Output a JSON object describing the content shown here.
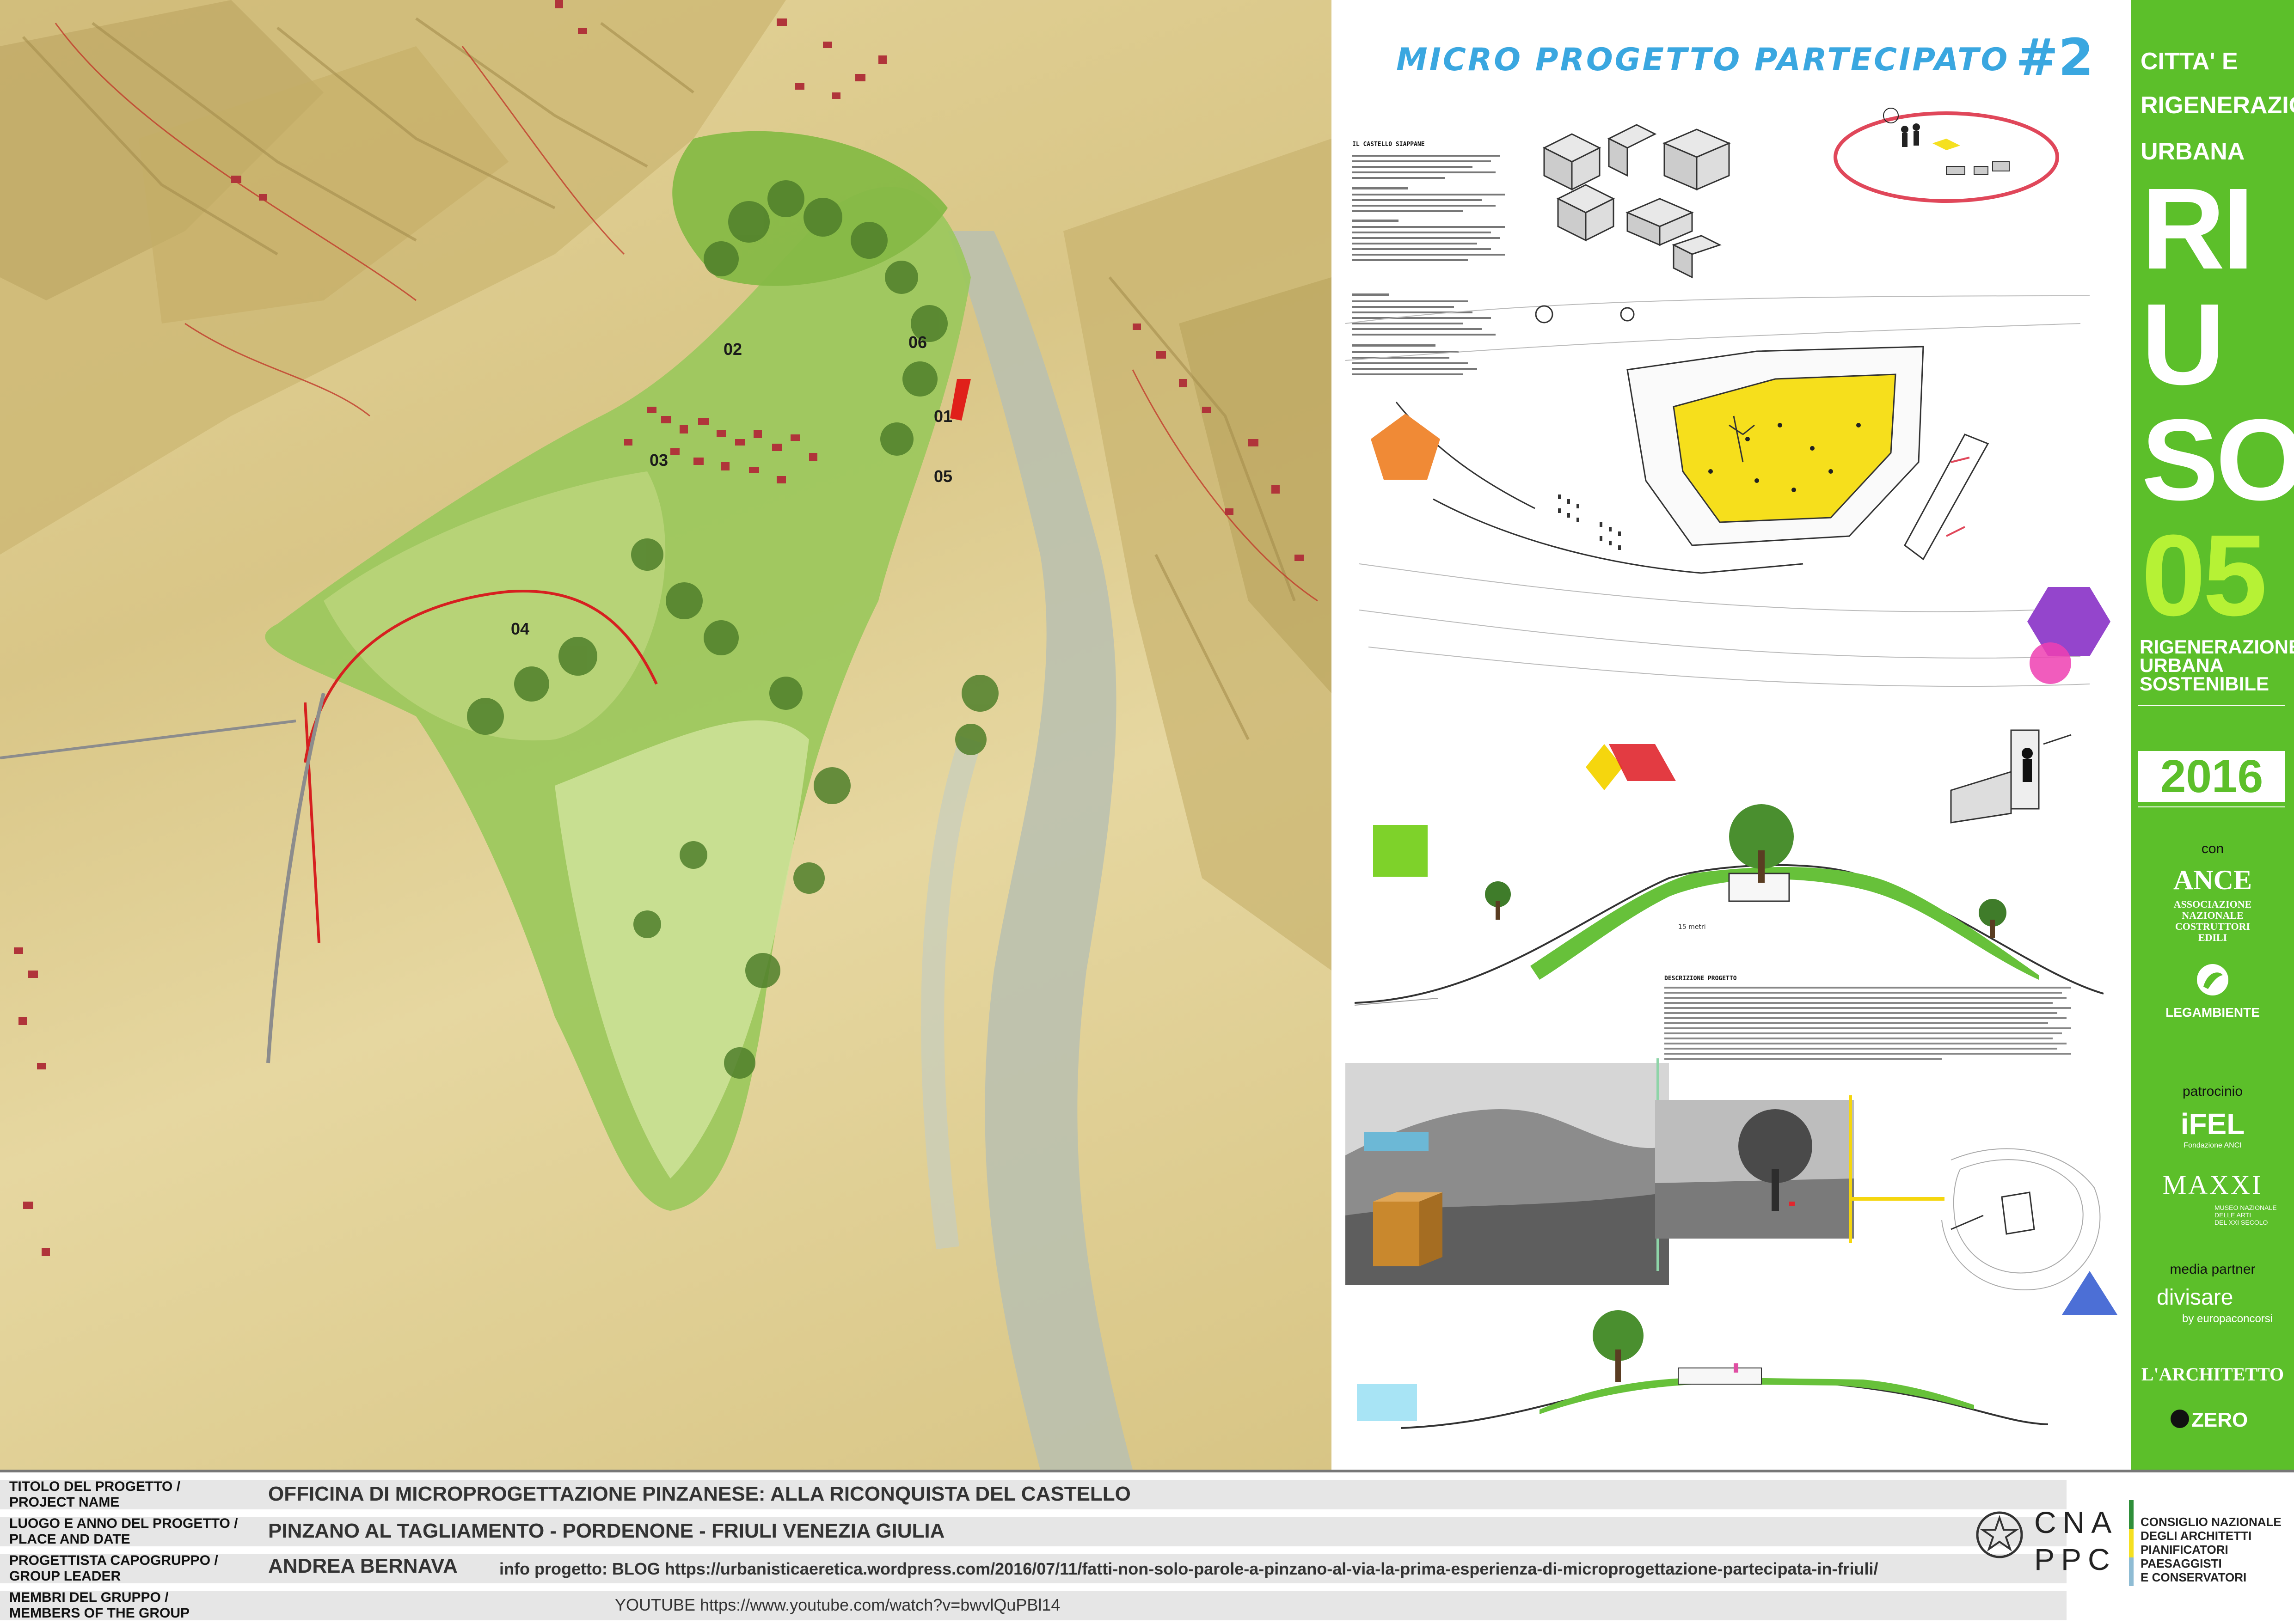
{
  "map": {
    "labels": [
      "01",
      "02",
      "03",
      "04",
      "05",
      "06"
    ]
  },
  "center": {
    "title": "MICRO PROGETTO PARTECIPATO",
    "title_number": "#2",
    "left_heading": "IL CASTELLO SIAPPANE",
    "section_heading_2": "DESCRIZIONE PROGETTO",
    "scale_label": "15 metri"
  },
  "sidebar": {
    "line1": "CITTA' E",
    "line2": "RIGENERAZIONE",
    "line3": "URBANA",
    "big1": "RI",
    "big2": "U",
    "big3": "SO",
    "big4": "05",
    "sub1": "RIGENERAZIONE",
    "sub2": "URBANA",
    "sub3": "SOSTENIBILE",
    "year": "2016",
    "con": "con",
    "ance": "ANCE",
    "ance_sub1": "ASSOCIAZIONE",
    "ance_sub2": "NAZIONALE",
    "ance_sub3": "COSTRUTTORI",
    "ance_sub4": "EDILI",
    "legambiente": "LEGAMBIENTE",
    "patrocinio": "patrocinio",
    "ifel": "iFEL",
    "ifel_sub": "Fondazione ANCI",
    "maxxi": "MAXXI",
    "maxxi_sub1": "MUSEO NAZIONALE",
    "maxxi_sub2": "DELLE ARTI",
    "maxxi_sub3": "DEL XXI SECOLO",
    "media_partner": "media partner",
    "divisare": "divisare",
    "divisare_sub": "by europaconcorsi",
    "architetto": "L'ARCHITETTO",
    "zero": "ZERO",
    "colors": {
      "green": "#5cbf2a"
    }
  },
  "footer": {
    "label1a": "TITOLO DEL PROGETTO /",
    "label1b": "PROJECT NAME",
    "value1": "OFFICINA DI MICROPROGETTAZIONE PINZANESE: ALLA RICONQUISTA DEL CASTELLO",
    "label2a": "LUOGO E ANNO DEL PROGETTO /",
    "label2b": "PLACE AND DATE",
    "value2": "PINZANO AL TAGLIAMENTO - PORDENONE - FRIULI VENEZIA GIULIA",
    "label3a": "PROGETTISTA CAPOGRUPPO /",
    "label3b": "GROUP LEADER",
    "value3": "ANDREA  BERNAVA",
    "info": "info progetto: BLOG https://urbanisticaeretica.wordpress.com/2016/07/11/fatti-non-solo-parole-a-pinzano-al-via-la-prima-esperienza-di-microprogettazione-partecipata-in-friuli/",
    "label4a": "MEMBRI DEL GRUPPO /",
    "label4b": "MEMBERS OF THE GROUP",
    "youtube": "YOUTUBE  https://www.youtube.com/watch?v=bwvlQuPBl14",
    "cnappc_1": "CNA",
    "cnappc_2": "PPC",
    "cnappc_t1": "CONSIGLIO NAZIONALE",
    "cnappc_t2": "DEGLI ARCHITETTI",
    "cnappc_t3": "PIANIFICATORI",
    "cnappc_t4": "PAESAGGISTI",
    "cnappc_t5": "E CONSERVATORI"
  }
}
